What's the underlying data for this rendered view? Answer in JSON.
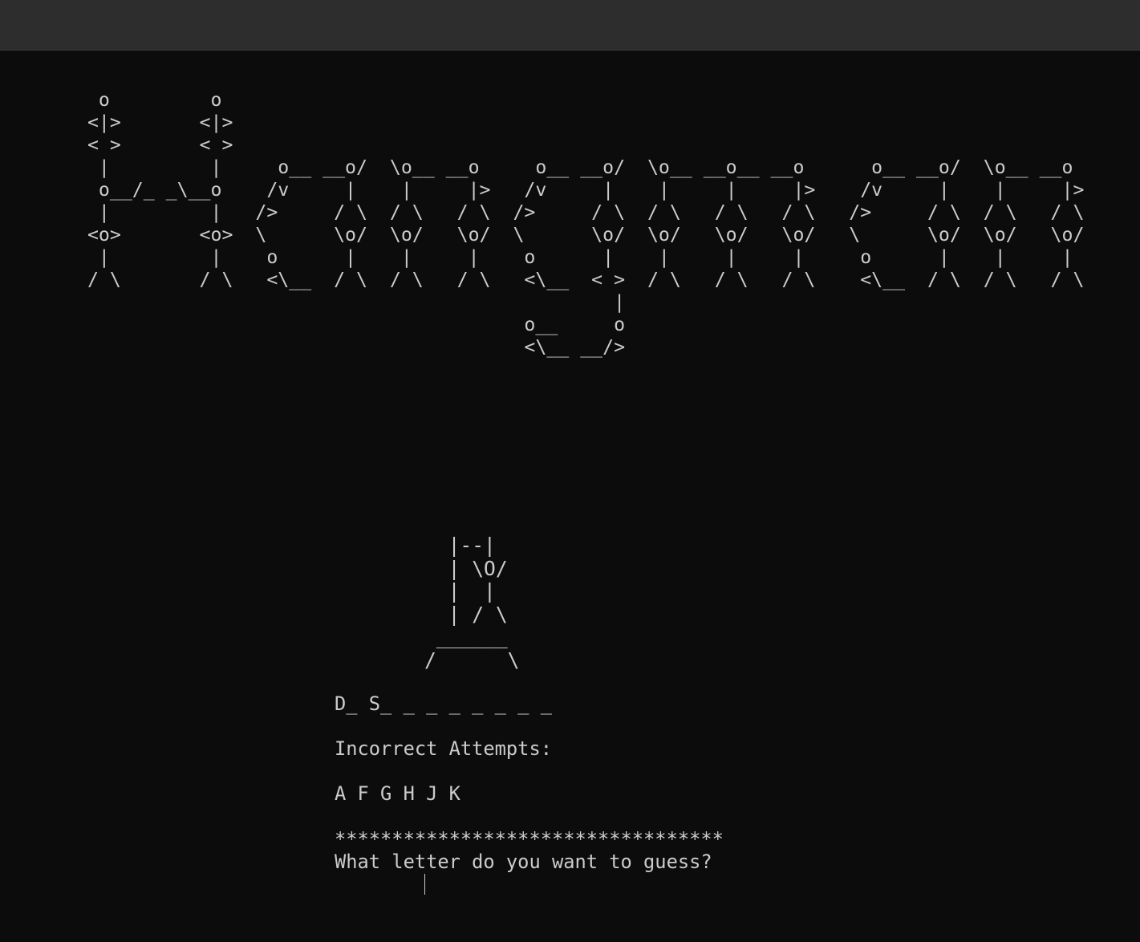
{
  "banner_art": "  o         o\n <|>       <|>\n < >       < >\n  |         |     o__ __o/  \\o__ __o     o__ __o/  \\o__ __o__ __o      o__ __o/  \\o__ __o\n  o__/_ _\\__o    /v     |    |     |>   /v     |    |     |     |>    /v     |    |     |>\n  |         |   />     / \\  / \\   / \\  />     / \\  / \\   / \\   / \\   />     / \\  / \\   / \\\n <o>       <o>  \\      \\o/  \\o/   \\o/  \\      \\o/  \\o/   \\o/   \\o/   \\      \\o/  \\o/   \\o/\n  |         |    o      |    |     |    o      |    |     |     |     o      |    |     |\n / \\       / \\   <\\__  / \\  / \\   / \\   <\\__  < >  / \\   / \\   / \\    <\\__  / \\  / \\   / \\\n                                                |\n                                        o__     o\n                                        <\\__ __/>",
  "gallows_art": "  |--|\n  | \\O/\n  |  |\n  | / \\\n ______\n/      \\",
  "word_display": "D_ S_ _ _ _ _ _ _ _",
  "incorrect_label": "Incorrect Attempts:",
  "incorrect_letters": "A F G H J K",
  "separator": "**********************************",
  "prompt": "What letter do you want to guess?"
}
